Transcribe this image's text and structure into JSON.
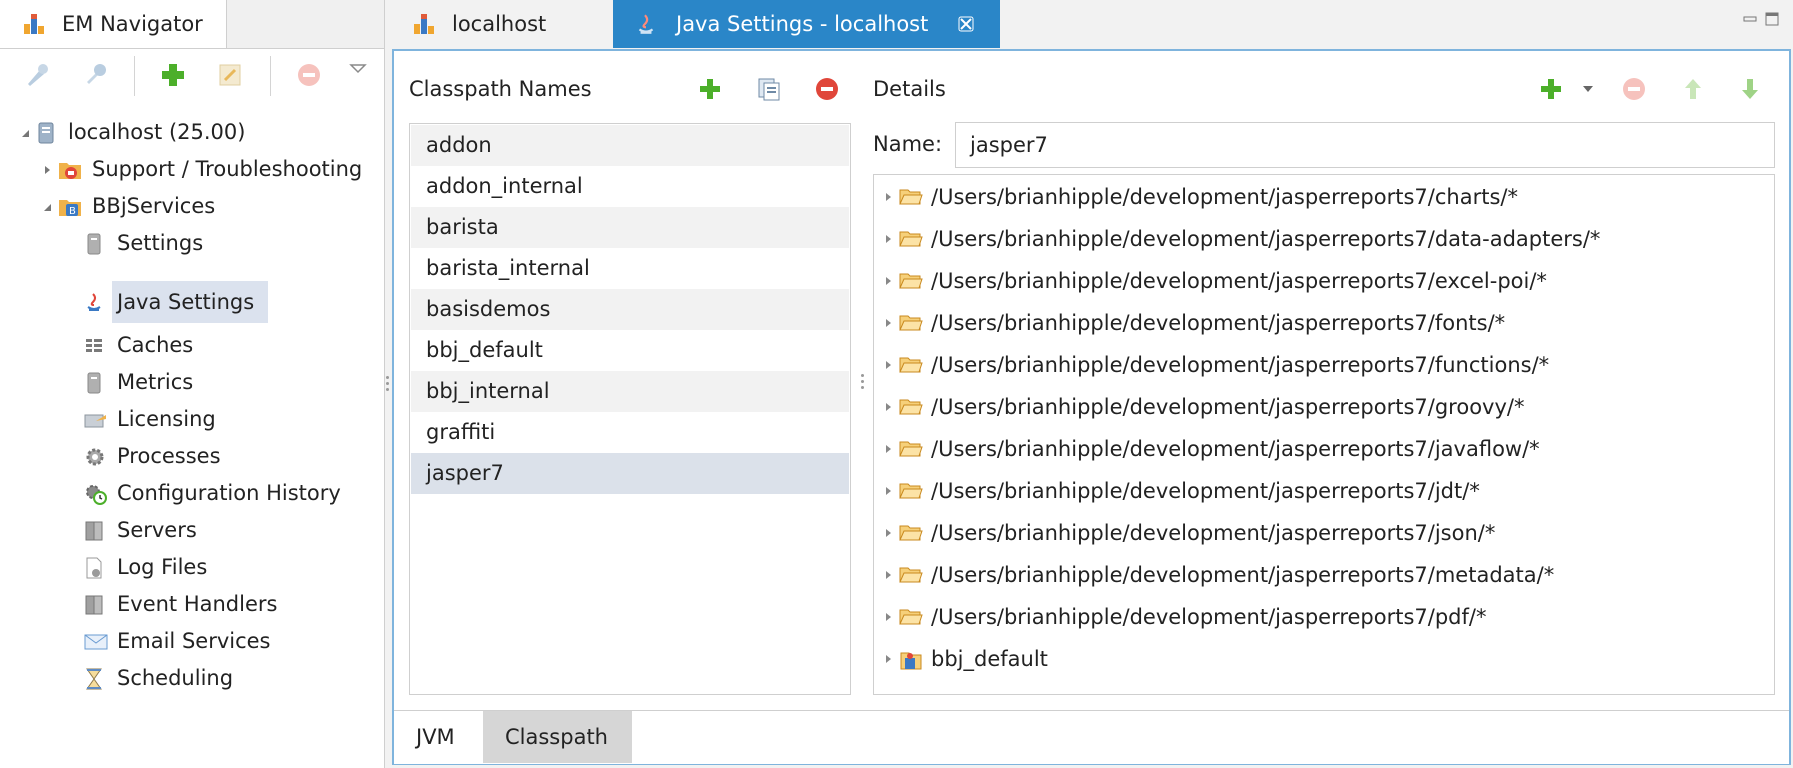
{
  "navigator": {
    "tab_label": "EM Navigator",
    "toolbar_icons": [
      "pin-icon",
      "unpin-icon",
      "add-icon",
      "edit-icon",
      "remove-icon",
      "view-menu-icon"
    ],
    "tree": [
      {
        "label": "localhost (25.00)",
        "icon": "server-icon"
      },
      {
        "label": "Support / Troubleshooting",
        "icon": "support-icon"
      },
      {
        "label": "BBjServices",
        "icon": "bbjservices-icon"
      },
      {
        "label": "Settings",
        "icon": "settings-icon"
      },
      {
        "label": "Java Settings",
        "icon": "java-icon",
        "selected": true
      },
      {
        "label": "Caches",
        "icon": "caches-icon"
      },
      {
        "label": "Metrics",
        "icon": "metrics-icon"
      },
      {
        "label": "Licensing",
        "icon": "licensing-icon"
      },
      {
        "label": "Processes",
        "icon": "processes-icon"
      },
      {
        "label": "Configuration History",
        "icon": "history-icon"
      },
      {
        "label": "Servers",
        "icon": "servers-icon"
      },
      {
        "label": "Log Files",
        "icon": "log-files-icon"
      },
      {
        "label": "Event Handlers",
        "icon": "event-handlers-icon"
      },
      {
        "label": "Email Services",
        "icon": "email-icon"
      },
      {
        "label": "Scheduling",
        "icon": "scheduling-icon"
      }
    ]
  },
  "editor_tabs": [
    {
      "label": "localhost",
      "icon": "localhost-icon"
    },
    {
      "label": "Java Settings - localhost",
      "icon": "java-icon",
      "active": true
    }
  ],
  "classpath_names": {
    "header": "Classpath Names",
    "items": [
      "addon",
      "addon_internal",
      "barista",
      "barista_internal",
      "basisdemos",
      "bbj_default",
      "bbj_internal",
      "graffiti",
      "jasper7"
    ],
    "selected": "jasper7"
  },
  "details": {
    "header": "Details",
    "name_label": "Name:",
    "name_value": "jasper7",
    "entries": [
      "/Users/brianhipple/development/jasperreports7/charts/*",
      "/Users/brianhipple/development/jasperreports7/data-adapters/*",
      "/Users/brianhipple/development/jasperreports7/excel-poi/*",
      "/Users/brianhipple/development/jasperreports7/fonts/*",
      "/Users/brianhipple/development/jasperreports7/functions/*",
      "/Users/brianhipple/development/jasperreports7/groovy/*",
      "/Users/brianhipple/development/jasperreports7/javaflow/*",
      "/Users/brianhipple/development/jasperreports7/jdt/*",
      "/Users/brianhipple/development/jasperreports7/json/*",
      "/Users/brianhipple/development/jasperreports7/metadata/*",
      "/Users/brianhipple/development/jasperreports7/pdf/*",
      "bbj_default"
    ]
  },
  "bottom_tabs": [
    {
      "label": "JVM"
    },
    {
      "label": "Classpath",
      "active": true
    }
  ],
  "colors": {
    "accent": "#2a86c8",
    "selection": "#dbe2ee",
    "add_green": "#4caf2a",
    "remove_red": "#e0463a",
    "folder": "#e9a93b"
  }
}
